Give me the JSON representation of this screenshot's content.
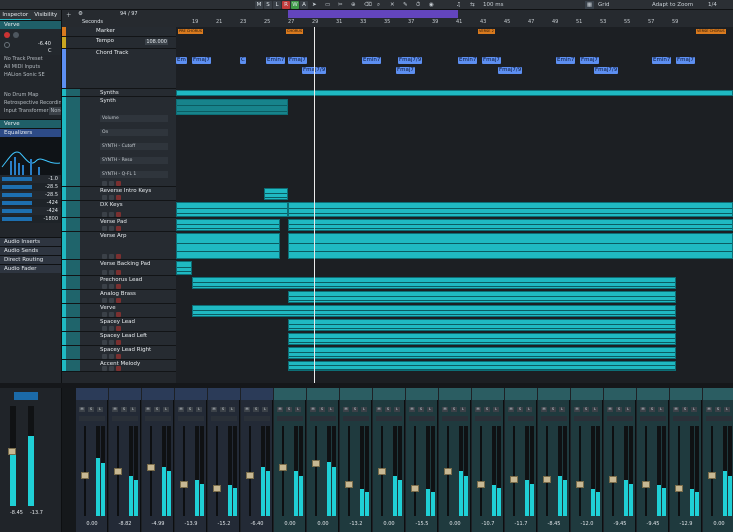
{
  "toolbar": {
    "marker_letters": [
      "M",
      "S",
      "L",
      "R",
      "W",
      "A"
    ],
    "position": "1/1",
    "time_readout": "100 ms",
    "grid_label": "Grid",
    "zoom_label": "Adapt to Zoom",
    "page_indicator": "1/4"
  },
  "inspector": {
    "tab_inspector": "Inspector",
    "tab_visibility": "Visibility",
    "track_name": "Verve",
    "volume_value": "-6.40",
    "pan_value": "C",
    "track_preset": "No Track Preset",
    "midi_input": "All MIDI Inputs",
    "instrument": "HALion Sonic SE",
    "drum_map": "No Drum Map",
    "retro_recording": "Retrospective Recording",
    "input_transformer_label": "Input Transformer",
    "input_transformer_value": "None",
    "eq_section": "Equalizers",
    "eq_values": [
      "-1.0",
      "-28.5",
      "-28.5",
      "-424",
      "-424",
      "-1800"
    ],
    "sections": [
      "Audio Inserts",
      "Audio Sends",
      "Direct Routing",
      "Audio Fader"
    ],
    "fader_value_left": "-8.45",
    "fader_value_right": "-13.7"
  },
  "ruler": {
    "seconds_label": "Seconds",
    "bars": [
      "19",
      "21",
      "23",
      "25",
      "27",
      "29",
      "31",
      "33",
      "35",
      "37",
      "39",
      "41",
      "43",
      "45",
      "47",
      "49",
      "51",
      "53",
      "55",
      "57",
      "59"
    ],
    "bar_counter": "94 / 97"
  },
  "tracks": [
    {
      "name": "Marker",
      "color": "#d97a1e"
    },
    {
      "name": "Tempo",
      "value": "108.000",
      "color": "#c9a520"
    },
    {
      "name": "Chord Track",
      "color": "#5d8ff1"
    },
    {
      "name": "Synths",
      "color": "#1fb9c2"
    },
    {
      "name": "Synth",
      "color": "#1fb9c2"
    },
    {
      "name": "Reverse Intro Keys",
      "color": "#1fb9c2"
    },
    {
      "name": "DX Keys",
      "color": "#1fb9c2"
    },
    {
      "name": "Verse Pad",
      "color": "#1fb9c2"
    },
    {
      "name": "Verse Arp",
      "color": "#1fb9c2"
    },
    {
      "name": "Verse Backing Pad",
      "color": "#1fb9c2"
    },
    {
      "name": "Prechorus Lead",
      "color": "#1fb9c2"
    },
    {
      "name": "Analog Brass",
      "color": "#1fb9c2"
    },
    {
      "name": "Verve",
      "color": "#1fb9c2"
    },
    {
      "name": "Spacey Lead",
      "color": "#1fb9c2"
    },
    {
      "name": "Spacey Lead Left",
      "color": "#1fb9c2"
    },
    {
      "name": "Spacey Lead Right",
      "color": "#1fb9c2"
    },
    {
      "name": "Accent Melody",
      "color": "#1fb9c2"
    }
  ],
  "automation_lanes": [
    "Volume",
    "On",
    "SYNTH - Cutoff",
    "SYNTH - Reso",
    "SYNTH - Q-FL 1"
  ],
  "markers": [
    "PRE CHORUS",
    "CHORUS",
    "VERSE 2",
    "VERSE CHORUS"
  ],
  "chords": [
    "Em",
    "Fmaj7",
    "C",
    "Emin7",
    "Fmaj7",
    "Fmaj7/9",
    "Emin7",
    "Fmaj7",
    "Fmaj7/9",
    "Emin7",
    "Fmaj7",
    "Fmaj7/9",
    "Emin7",
    "Fmaj7",
    "Fmaj7/9",
    "Emin7",
    "Fmaj7"
  ],
  "mixer": {
    "volumes": [
      "0.00",
      "-8.82",
      "-4.99",
      "-13.9",
      "-15.2",
      "-6.40",
      "0.00",
      "0.00",
      "-13.2",
      "0.00",
      "-15.5",
      "0.00",
      "-10.7",
      "-11.7",
      "-8.45",
      "-12.0",
      "-9.45",
      "-9.45",
      "-12.9",
      "0.00"
    ],
    "meter_levels": [
      0.65,
      0.45,
      0.55,
      0.4,
      0.35,
      0.55,
      0.5,
      0.6,
      0.3,
      0.45,
      0.3,
      0.5,
      0.35,
      0.4,
      0.45,
      0.3,
      0.4,
      0.35,
      0.3,
      0.5
    ],
    "fader_levels": [
      0.45,
      0.5,
      0.55,
      0.35,
      0.3,
      0.45,
      0.55,
      0.6,
      0.35,
      0.5,
      0.3,
      0.5,
      0.35,
      0.4,
      0.4,
      0.35,
      0.4,
      0.35,
      0.3,
      0.45
    ]
  },
  "colors": {
    "accent": "#1fb9c2",
    "chord": "#5d8ff1",
    "marker": "#d97a1e",
    "fader_cap": "#c7b893"
  }
}
